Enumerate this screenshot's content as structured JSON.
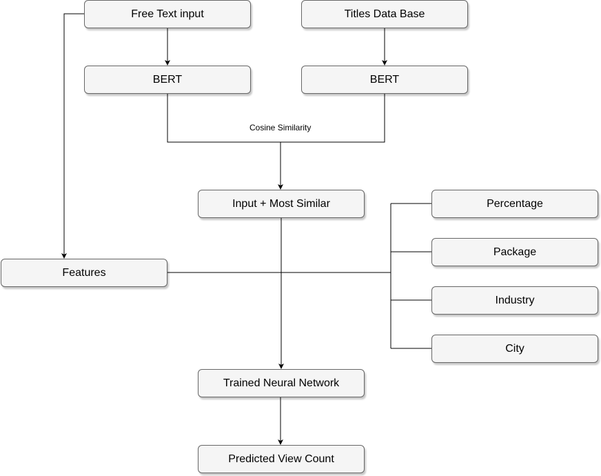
{
  "nodes": {
    "free_text": "Free Text input",
    "titles_db": "Titles Data Base",
    "bert_left": "BERT",
    "bert_right": "BERT",
    "input_similar": "Input + Most Similar",
    "features": "Features",
    "percentage": "Percentage",
    "package": "Package",
    "industry": "Industry",
    "city": "City",
    "trained_nn": "Trained Neural Network",
    "predicted": "Predicted View Count"
  },
  "edge_labels": {
    "cosine": "Cosine Similarity"
  },
  "colors": {
    "node_fill": "#f5f5f5",
    "node_stroke": "#666666",
    "edge": "#000000"
  }
}
